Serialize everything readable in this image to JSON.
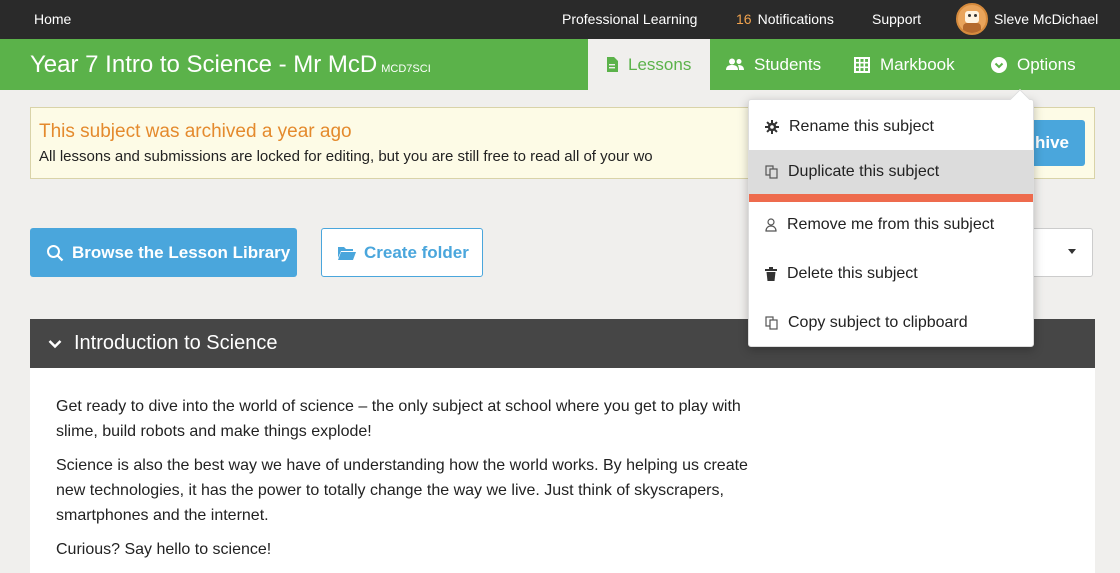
{
  "topnav": {
    "home": "Home",
    "professional_learning": "Professional Learning",
    "notifications_count": "16",
    "notifications_label": "Notifications",
    "support": "Support",
    "user_name": "Sleve McDichael"
  },
  "subject": {
    "title": "Year 7 Intro to Science - Mr McD",
    "code": "MCD7SCI"
  },
  "tabs": {
    "lessons": "Lessons",
    "students": "Students",
    "markbook": "Markbook",
    "options": "Options"
  },
  "notice": {
    "heading": "This subject was archived a year ago",
    "body": "All lessons and submissions are locked for editing, but you are still free to read all of your wo",
    "unarchive_visible": "hive"
  },
  "actions": {
    "browse_library": "Browse the Lesson Library",
    "create_folder": "Create folder"
  },
  "section": {
    "title": "Introduction to Science",
    "paragraphs": [
      "Get ready to dive into the world of science – the only subject at school where you get to play with slime, build robots and make things explode!",
      "Science is also the best way we have of understanding how the world works. By helping us create new technologies, it has the power to totally change the way we live. Just think of skyscrapers, smartphones and the internet.",
      "Curious? Say hello to science!"
    ]
  },
  "options_menu": {
    "items": [
      {
        "label": "Rename this subject",
        "icon": "gear-icon"
      },
      {
        "label": "Duplicate this subject",
        "icon": "copy-icon"
      },
      {
        "label": "Remove me from this subject",
        "icon": "person-icon"
      },
      {
        "label": "Delete this subject",
        "icon": "trash-icon"
      },
      {
        "label": "Copy subject to clipboard",
        "icon": "copy-icon"
      }
    ]
  },
  "colors": {
    "green": "#5bb24a",
    "blue": "#4aa6dc",
    "orange": "#e48a2d",
    "hover_underline": "#ee6b4d"
  }
}
